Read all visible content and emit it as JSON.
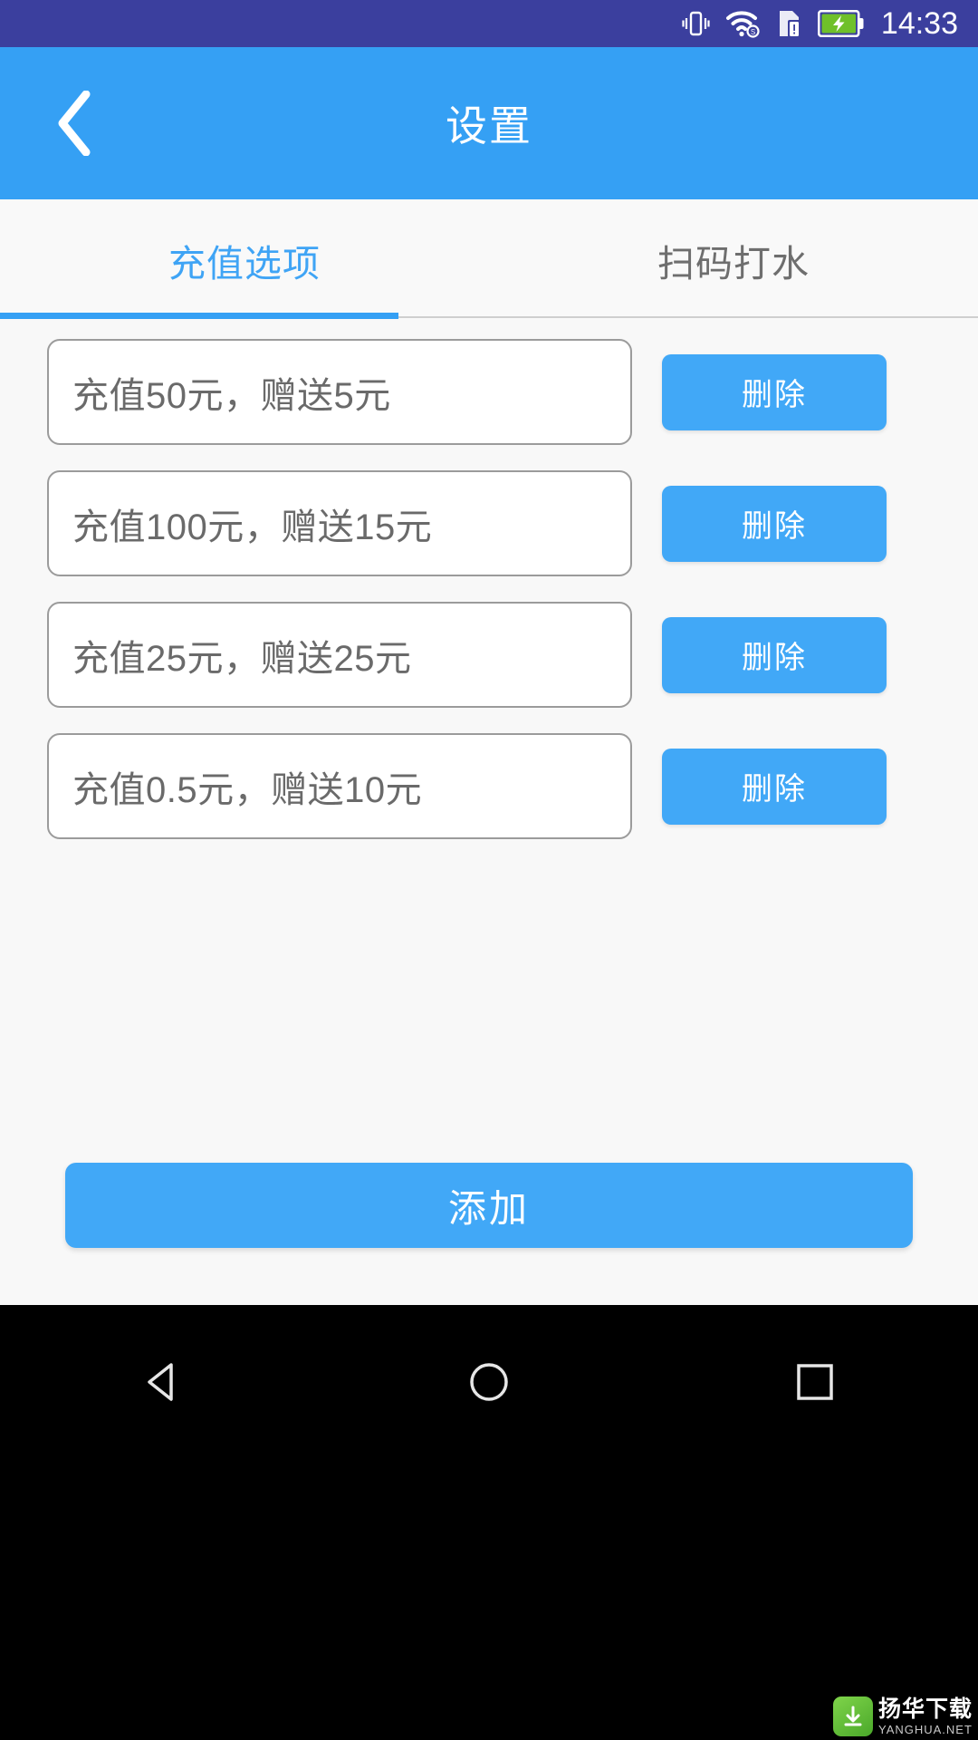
{
  "status_bar": {
    "time": "14:33",
    "background_color": "#3b3f9e",
    "icons": [
      {
        "name": "vibrate-icon",
        "label": "vibrate"
      },
      {
        "name": "wifi-icon",
        "label": "wifi"
      },
      {
        "name": "sim-card-alert-icon",
        "label": "sim-alert"
      },
      {
        "name": "battery-charging-icon",
        "label": "battery-charging"
      }
    ]
  },
  "app_bar": {
    "title": "设置",
    "back_icon": "chevron-left-icon",
    "background_color": "#35a0f4"
  },
  "tabs": {
    "items": [
      {
        "label": "充值选项",
        "active": true
      },
      {
        "label": "扫码打水",
        "active": false
      }
    ],
    "active_color": "#3fa4f5",
    "inactive_color": "#6e6e6e",
    "indicator_color": "#35a0f4"
  },
  "list": {
    "delete_label": "删除",
    "rows": [
      {
        "value": "充值50元，赠送5元"
      },
      {
        "value": "充值100元，赠送15元"
      },
      {
        "value": "充值25元，赠送25元"
      },
      {
        "value": "充值0.5元，赠送10元"
      }
    ]
  },
  "footer": {
    "add_label": "添加",
    "add_color": "#41a8f7"
  },
  "nav_bar": {
    "buttons": [
      {
        "name": "nav-back-icon",
        "label": "back"
      },
      {
        "name": "nav-home-icon",
        "label": "home"
      },
      {
        "name": "nav-recents-icon",
        "label": "recents"
      }
    ]
  },
  "watermark": {
    "main": "扬华下载",
    "sub": "YANGHUA.NET"
  }
}
